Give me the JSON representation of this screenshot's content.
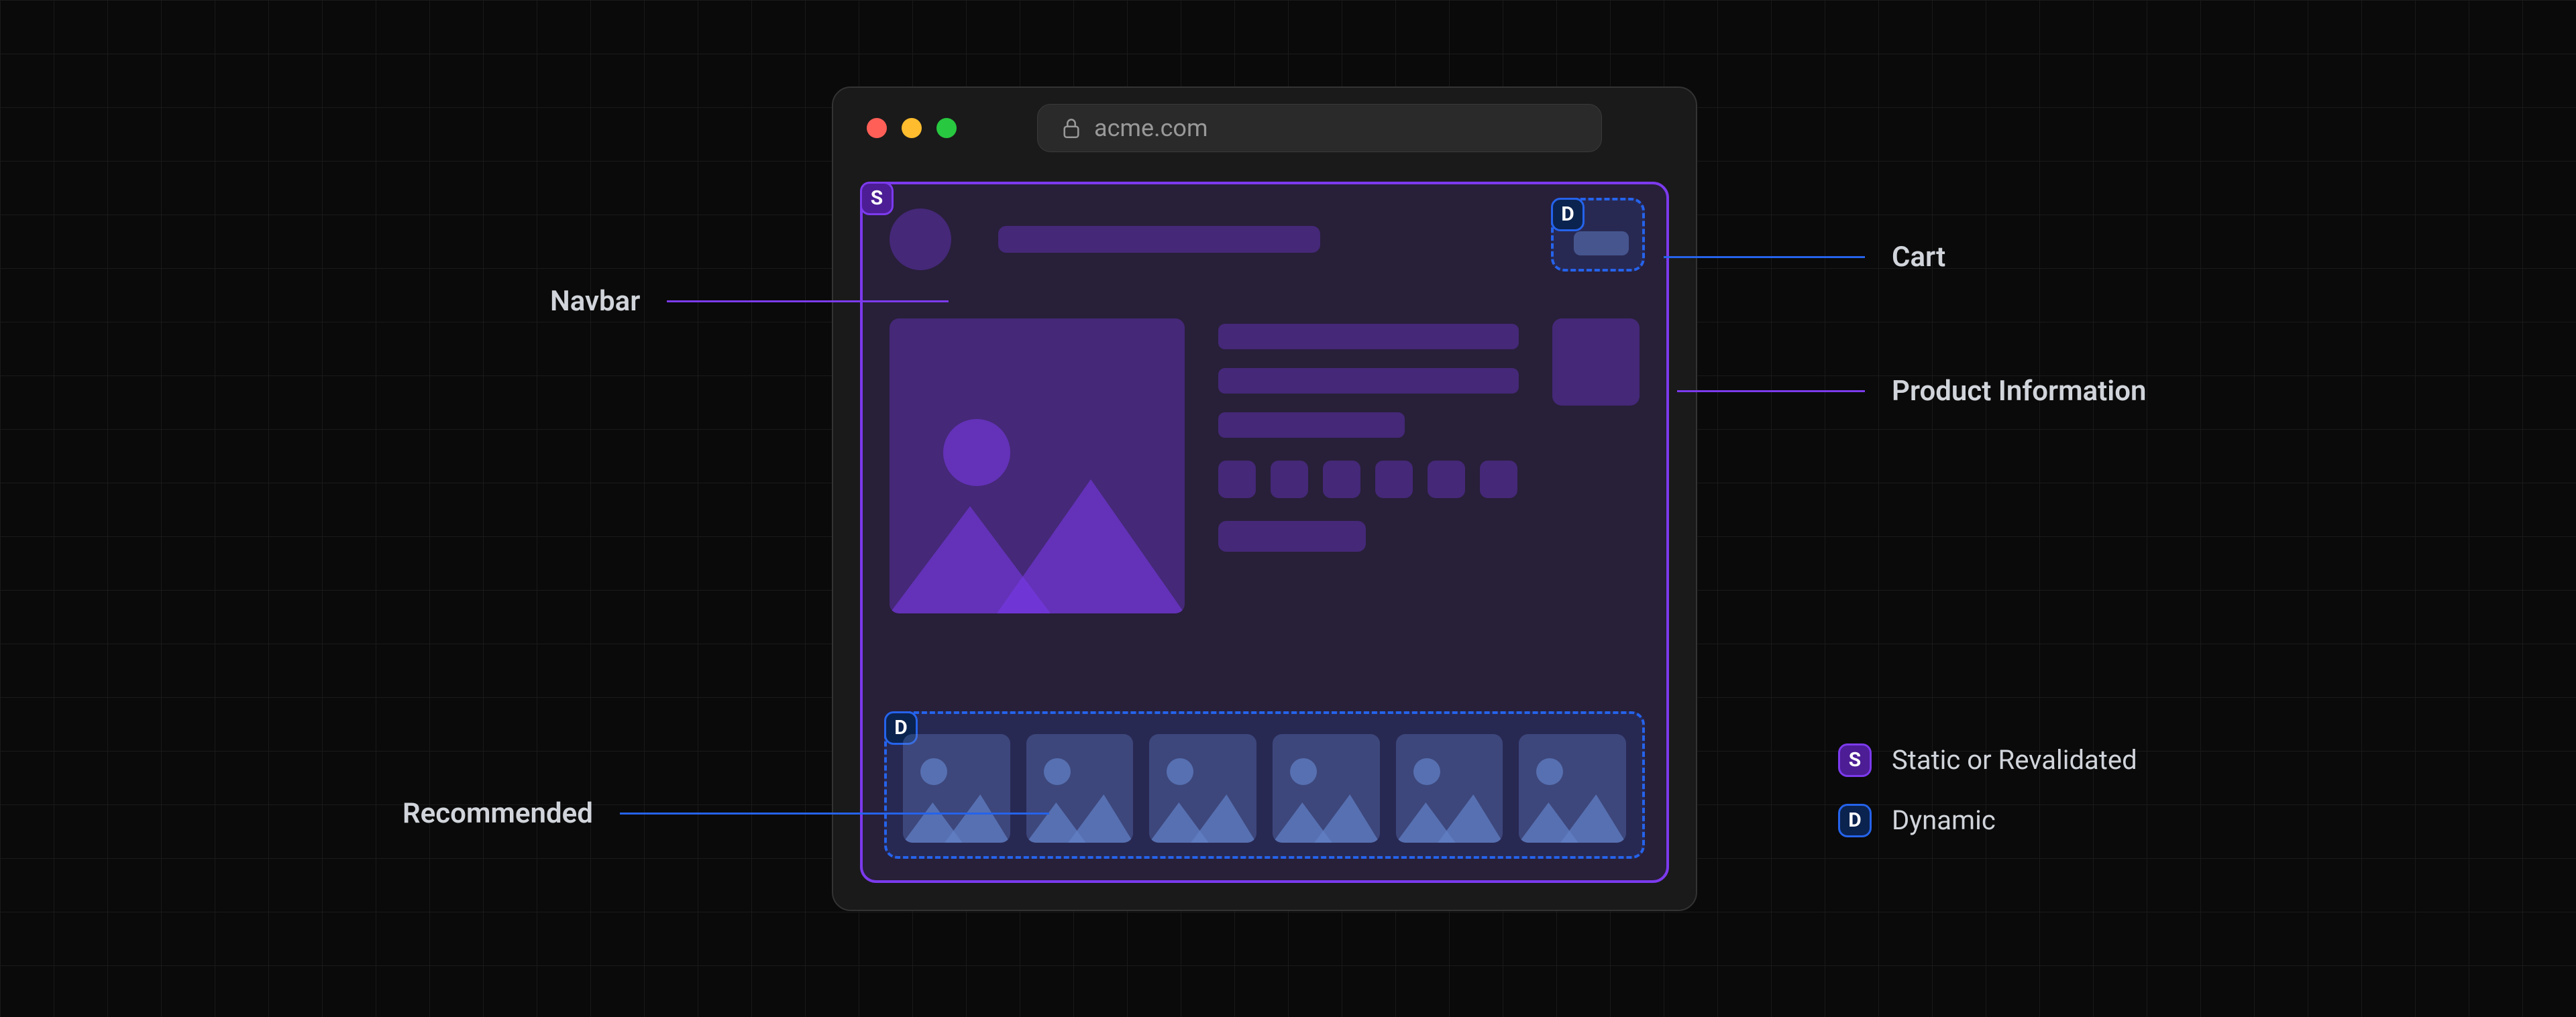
{
  "diagram": {
    "url": "acme.com",
    "badges": {
      "static": "S",
      "dynamic": "D"
    },
    "callouts": {
      "navbar": "Navbar",
      "cart": "Cart",
      "product_info": "Product Information",
      "recommended": "Recommended"
    },
    "legend": {
      "static": "Static or Revalidated",
      "dynamic": "Dynamic"
    },
    "wireframe": {
      "swatch_count": 6,
      "recommended_count": 6
    }
  }
}
